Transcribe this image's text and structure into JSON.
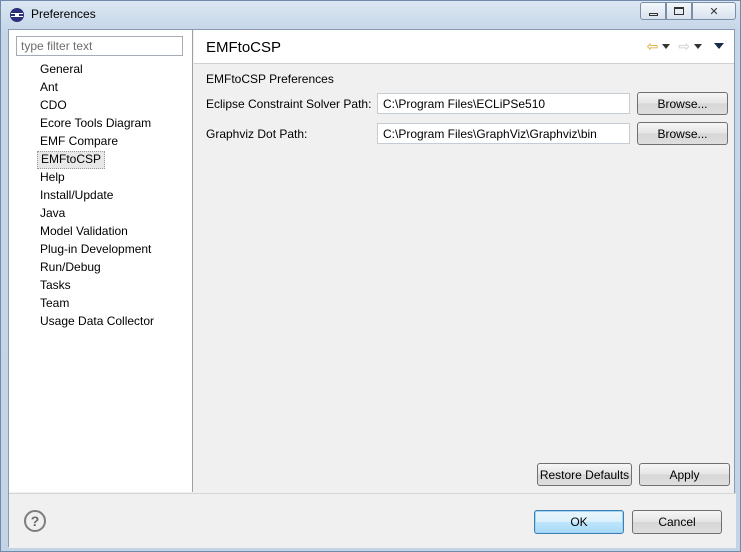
{
  "window": {
    "title": "Preferences"
  },
  "sidebar": {
    "filter_placeholder": "type filter text",
    "items": [
      {
        "label": "General"
      },
      {
        "label": "Ant"
      },
      {
        "label": "CDO"
      },
      {
        "label": "Ecore Tools Diagram"
      },
      {
        "label": "EMF Compare"
      },
      {
        "label": "EMFtoCSP",
        "selected": true
      },
      {
        "label": "Help"
      },
      {
        "label": "Install/Update"
      },
      {
        "label": "Java"
      },
      {
        "label": "Model Validation"
      },
      {
        "label": "Plug-in Development"
      },
      {
        "label": "Run/Debug"
      },
      {
        "label": "Tasks"
      },
      {
        "label": "Team"
      },
      {
        "label": "Usage Data Collector"
      }
    ]
  },
  "page": {
    "title": "EMFtoCSP",
    "section_label": "EMFtoCSP Preferences",
    "fields": [
      {
        "label": "Eclipse Constraint Solver Path:",
        "value": "C:\\Program Files\\ECLiPSe510",
        "browse_label": "Browse..."
      },
      {
        "label": "Graphviz Dot Path:",
        "value": "C:\\Program Files\\GraphViz\\Graphviz\\bin",
        "browse_label": "Browse..."
      }
    ],
    "restore_defaults_label": "Restore Defaults",
    "apply_label": "Apply"
  },
  "footer": {
    "help_glyph": "?",
    "ok_label": "OK",
    "cancel_label": "Cancel"
  },
  "icons": {
    "back": "left-arrow-icon",
    "forward": "right-arrow-icon",
    "menu": "view-menu-icon",
    "help": "help-icon"
  },
  "colors": {
    "back_arrow": "#e0a020",
    "ok_border": "#3c7fb1"
  }
}
